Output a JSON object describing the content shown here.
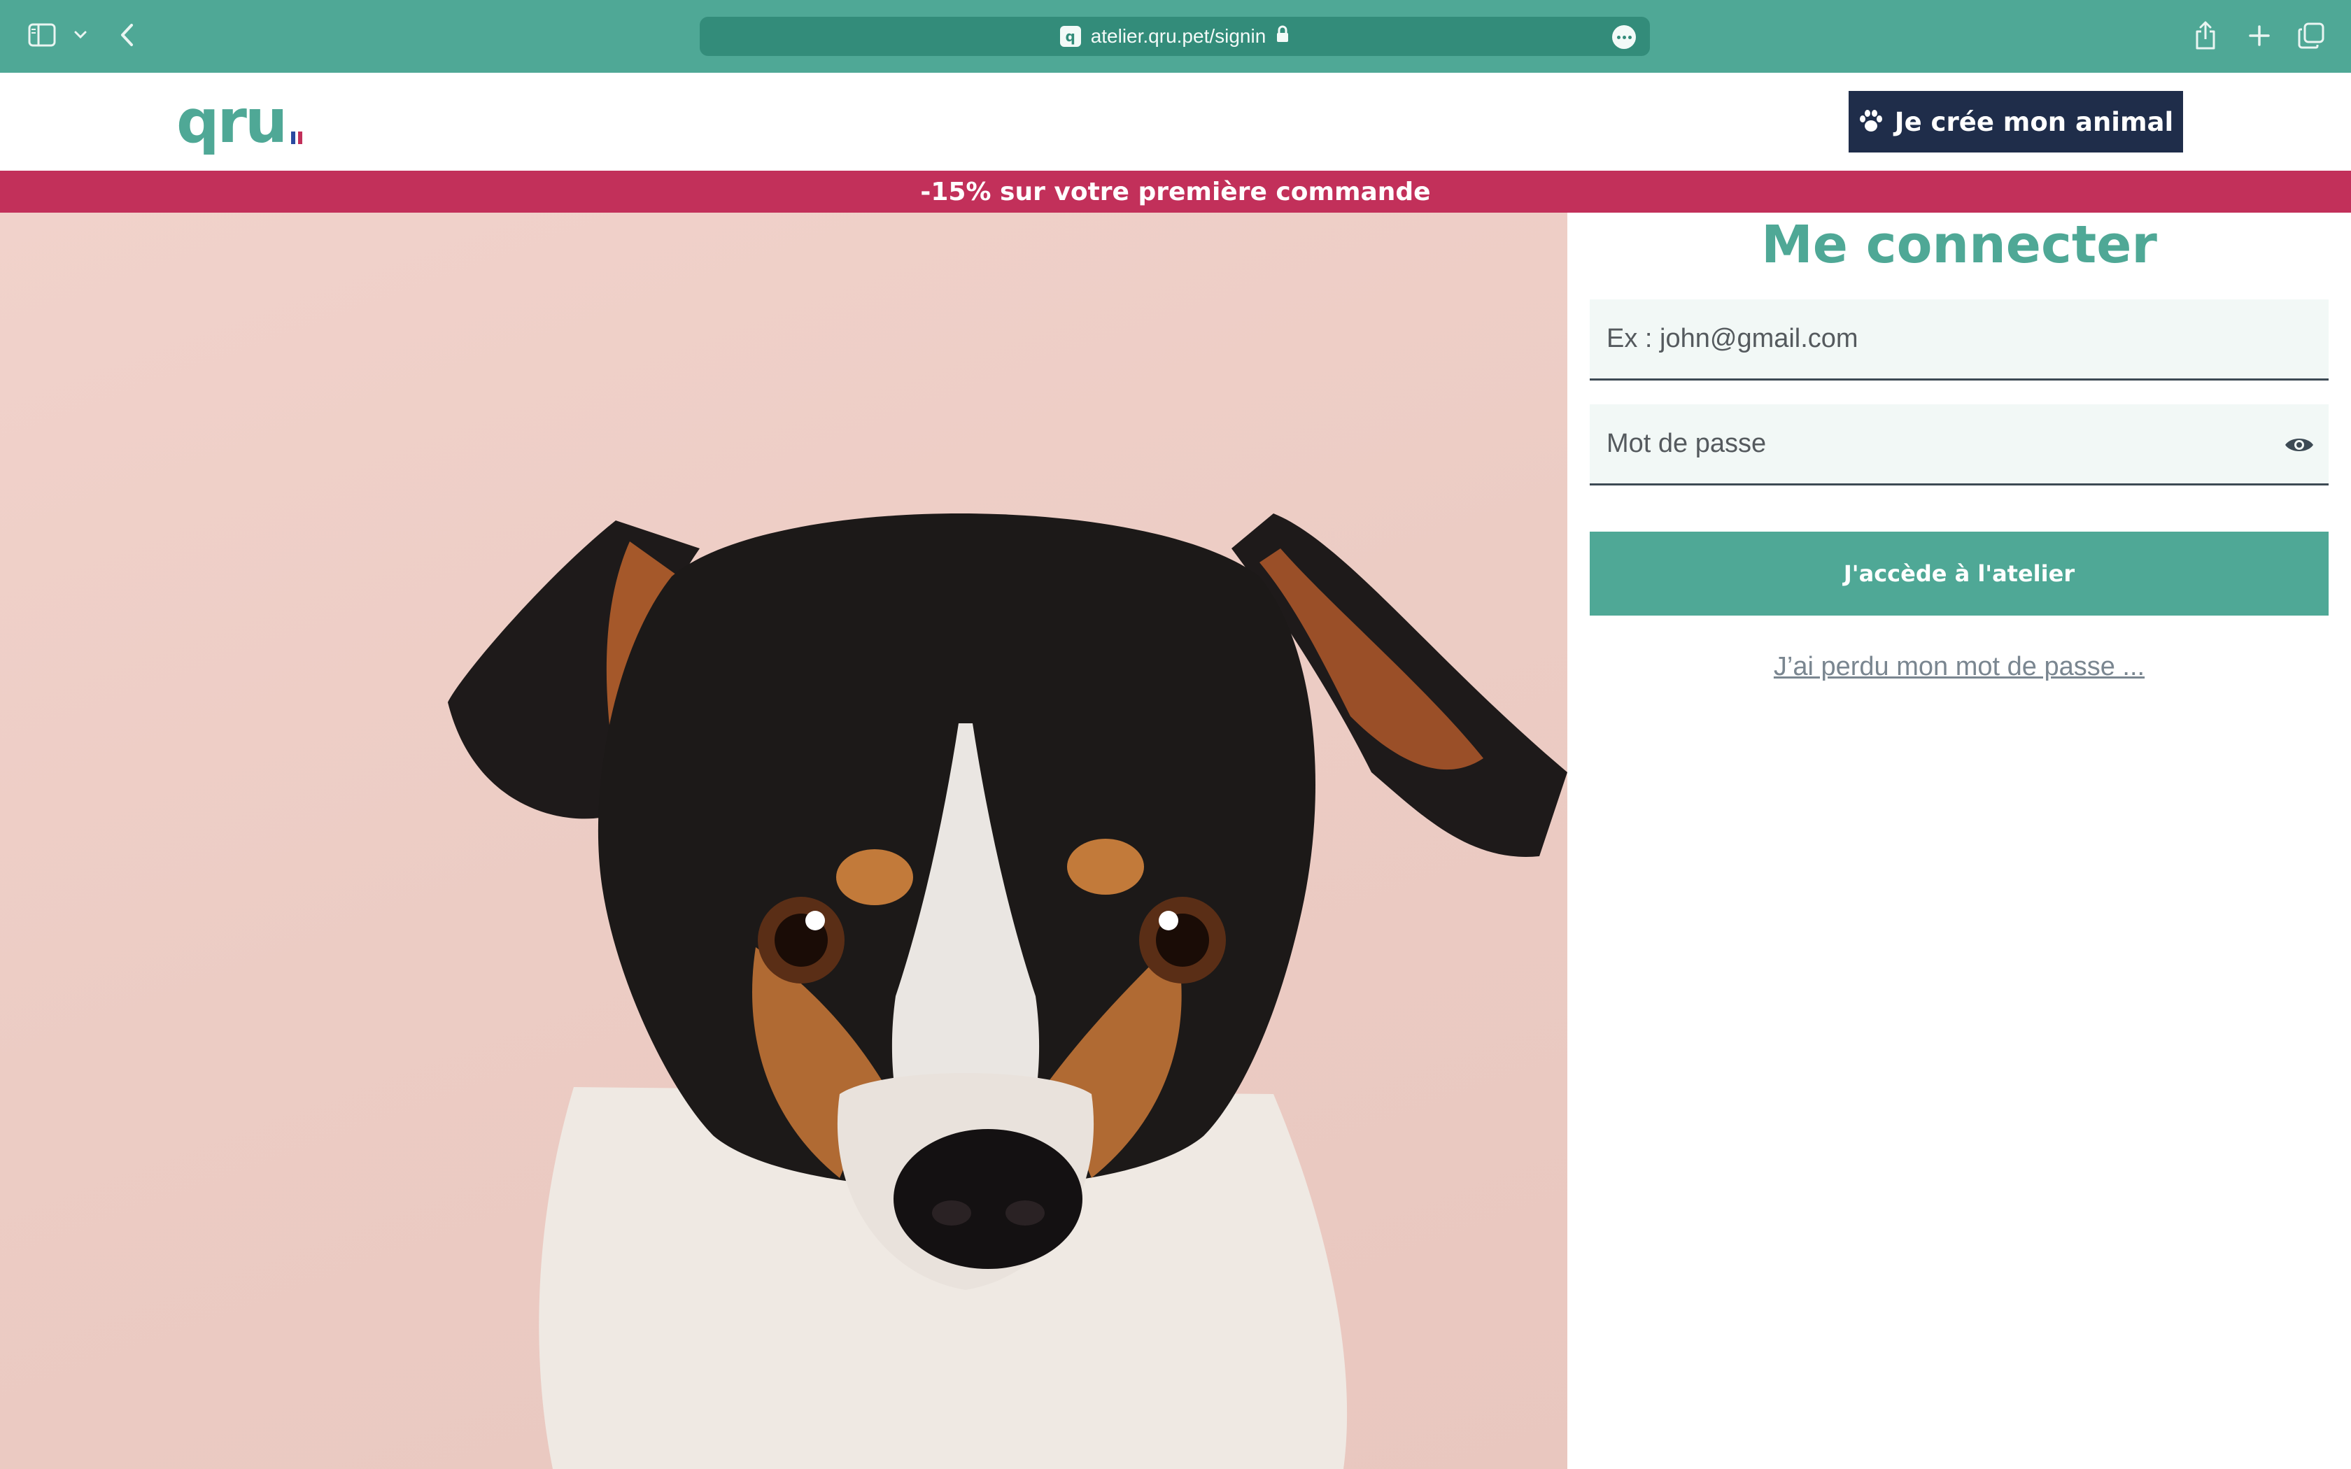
{
  "browser": {
    "url": "atelier.qru.pet/signin",
    "icons": [
      "sidebar-icon",
      "chevron-down-icon",
      "back-icon",
      "lock-icon",
      "more-icon",
      "share-icon",
      "plus-icon",
      "tabs-icon"
    ]
  },
  "header": {
    "logo_text": "qru",
    "cta_label": "Je crée mon animal",
    "cta_icon": "paw-icon"
  },
  "promo": {
    "text": "-15% sur votre première commande"
  },
  "login": {
    "title": "Me connecter",
    "email_placeholder": "Ex : john@gmail.com",
    "email_value": "",
    "password_placeholder": "Mot de passe",
    "password_value": "",
    "submit_label": "J'accède à l'atelier",
    "forgot_label": "J’ai perdu mon mot de passe ..."
  },
  "colors": {
    "brand": "#4fa896",
    "navy": "#1f2d4a",
    "promo": "#c2305a",
    "hero_bg": "#ecccc4"
  }
}
